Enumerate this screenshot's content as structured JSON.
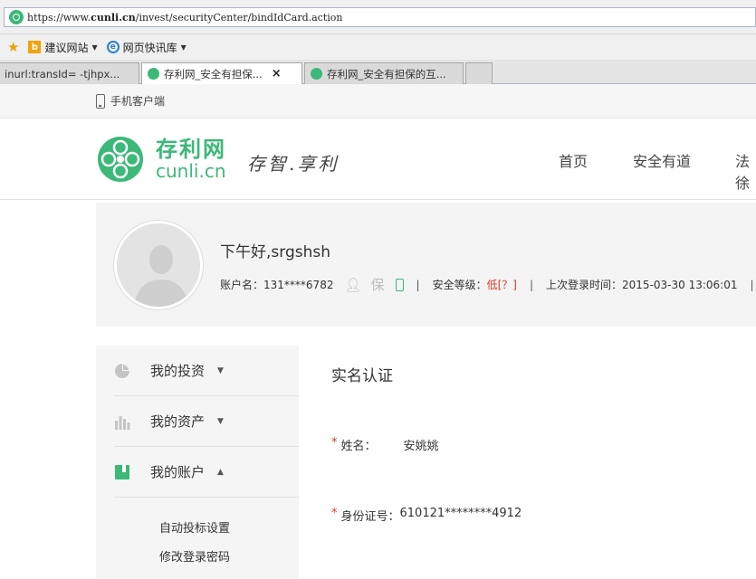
{
  "browser": {
    "url_prefix": "https://www.",
    "url_host": "cunli.cn",
    "url_path": "/invest/securityCenter/bindIdCard.action",
    "favorites": [
      {
        "label": "建议网站"
      },
      {
        "label": "网页快讯库"
      }
    ],
    "tabs": [
      {
        "label": "inurl:transId= -tjhpx..."
      },
      {
        "label": "存利网_安全有担保..."
      },
      {
        "label": "存利网_安全有担保的互..."
      }
    ],
    "tab_close": "×"
  },
  "topbar": {
    "mobile_label": "手机客户端"
  },
  "header": {
    "logo_cn": "存利网",
    "logo_en": "cunli.cn",
    "slogan": "存智.享利",
    "nav": [
      "首页",
      "安全有道",
      "法徐"
    ]
  },
  "user": {
    "greeting": "下午好,srgshsh",
    "account_label": "账户名：",
    "account_value": "131****6782",
    "bao": "保",
    "security_label": "安全等级：",
    "security_value": "低[？]",
    "last_login_label": "上次登录时间：",
    "last_login_value": "2015-03-30 13:06:01",
    "separator": "|"
  },
  "sidebar": {
    "items": [
      {
        "label": "我的投资",
        "caret": "▼"
      },
      {
        "label": "我的资产",
        "caret": "▼"
      },
      {
        "label": "我的账户",
        "caret": "▲"
      }
    ],
    "sub_items": [
      "自动投标设置",
      "修改登录密码"
    ]
  },
  "main": {
    "title": "实名认证",
    "required_mark": "*",
    "name_label": "姓名：",
    "name_value": "安姚姚",
    "id_label": "身份证号：",
    "id_value": "610121********4912"
  },
  "colors": {
    "brand": "#3cb878",
    "risk": "#d9362b"
  }
}
